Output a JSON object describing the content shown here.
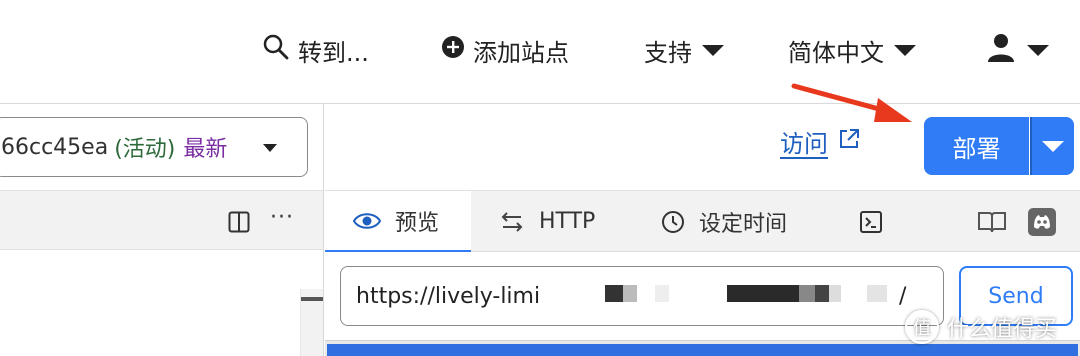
{
  "topnav": {
    "goto_label": "转到...",
    "add_site_label": "添加站点",
    "support_label": "支持",
    "language_label": "简体中文"
  },
  "left_pane": {
    "deployment": {
      "hash": "66cc45ea",
      "status": "(活动)",
      "tag": "最新"
    },
    "toolbar": {
      "more_label": "···"
    }
  },
  "right_pane": {
    "visit_label": "访问",
    "deploy_label": "部署",
    "tabs": [
      {
        "label": "预览",
        "icon": "eye-icon",
        "active": true
      },
      {
        "label": "HTTP",
        "icon": "swap-arrows-icon",
        "active": false
      },
      {
        "label": "设定时间",
        "icon": "clock-icon",
        "active": false
      },
      {
        "label": "",
        "icon": "terminal-icon",
        "active": false
      },
      {
        "label": "",
        "icon": "book-icon",
        "active": false
      },
      {
        "label": "",
        "icon": "discord-icon",
        "active": false
      }
    ],
    "url_value": "https://lively-limi",
    "url_tail": "/",
    "send_label": "Send"
  },
  "watermark": {
    "badge": "值",
    "text": "什么值得买"
  },
  "colors": {
    "accent": "#2f7cf6",
    "link": "#1f5fbf",
    "status_active": "#2d6a3a",
    "tag_latest": "#7a2ea1",
    "arrow": "#e8391f"
  }
}
